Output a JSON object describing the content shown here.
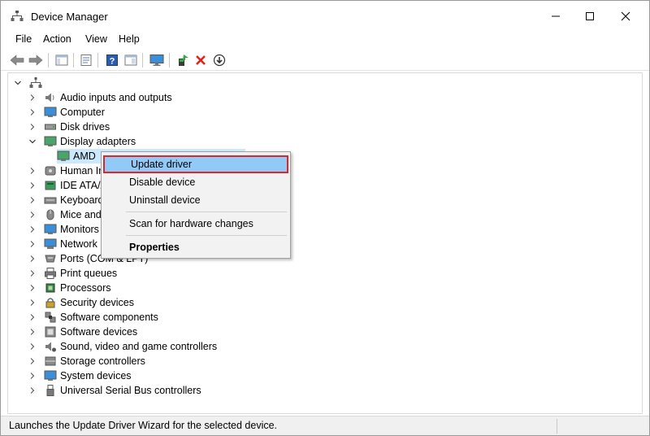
{
  "window": {
    "title": "Device Manager"
  },
  "menu": [
    "File",
    "Action",
    "View",
    "Help"
  ],
  "toolbar": {
    "icons": [
      "back-icon",
      "forward-icon",
      "show-hide-tree-icon",
      "properties-icon",
      "help-icon",
      "view-icon",
      "monitor-icon",
      "update-driver-icon",
      "uninstall-icon",
      "download-icon"
    ]
  },
  "tree": {
    "root_icon": "computer-root-icon",
    "items": [
      {
        "label": "Audio inputs and outputs",
        "icon": "speaker-icon",
        "expanded": false
      },
      {
        "label": "Computer",
        "icon": "computer-icon",
        "expanded": false
      },
      {
        "label": "Disk drives",
        "icon": "disk-icon",
        "expanded": false
      },
      {
        "label": "Display adapters",
        "icon": "display-adapter-icon",
        "expanded": true
      },
      {
        "label": "AMD",
        "icon": "display-adapter-icon",
        "child": true
      },
      {
        "label": "Human Ir",
        "icon": "hid-icon",
        "expanded": false
      },
      {
        "label": "IDE ATA/A",
        "icon": "ide-icon",
        "expanded": false
      },
      {
        "label": "Keyboard",
        "icon": "keyboard-icon",
        "expanded": false
      },
      {
        "label": "Mice and",
        "icon": "mouse-icon",
        "expanded": false
      },
      {
        "label": "Monitors",
        "icon": "monitor-icon",
        "expanded": false
      },
      {
        "label": "Network",
        "icon": "network-icon",
        "expanded": false
      },
      {
        "label": "Ports (COM & LPT)",
        "icon": "port-icon",
        "expanded": false
      },
      {
        "label": "Print queues",
        "icon": "printer-icon",
        "expanded": false
      },
      {
        "label": "Processors",
        "icon": "processor-icon",
        "expanded": false
      },
      {
        "label": "Security devices",
        "icon": "security-icon",
        "expanded": false
      },
      {
        "label": "Software components",
        "icon": "software-component-icon",
        "expanded": false
      },
      {
        "label": "Software devices",
        "icon": "software-device-icon",
        "expanded": false
      },
      {
        "label": "Sound, video and game controllers",
        "icon": "sound-icon",
        "expanded": false
      },
      {
        "label": "Storage controllers",
        "icon": "storage-icon",
        "expanded": false
      },
      {
        "label": "System devices",
        "icon": "system-icon",
        "expanded": false
      },
      {
        "label": "Universal Serial Bus controllers",
        "icon": "usb-icon",
        "expanded": false
      }
    ]
  },
  "context_menu": {
    "items": [
      {
        "label": "Update driver",
        "highlighted": true
      },
      {
        "label": "Disable device"
      },
      {
        "label": "Uninstall device"
      },
      {
        "label": "Scan for hardware changes"
      },
      {
        "label": "Properties",
        "bold": true
      }
    ]
  },
  "status": {
    "text": "Launches the Update Driver Wizard for the selected device."
  },
  "colors": {
    "highlight": "#91c9f7",
    "highlight_border": "#e0242b",
    "selection": "#cce8ff"
  }
}
